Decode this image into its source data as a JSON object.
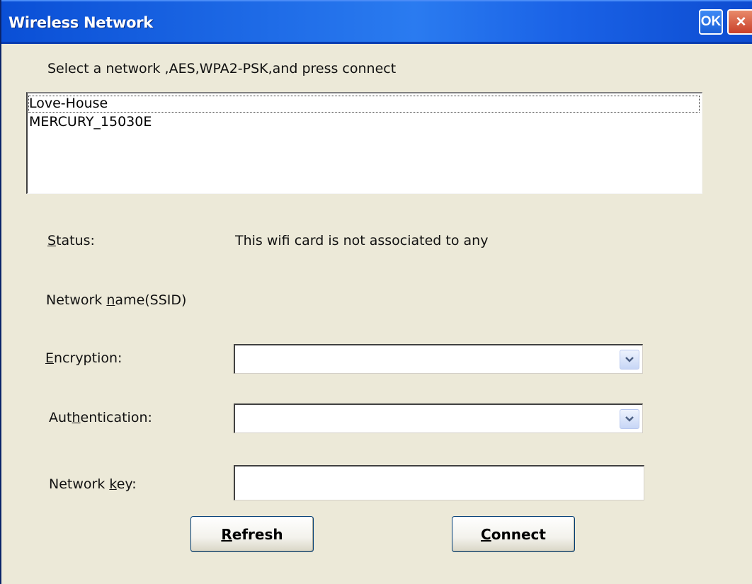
{
  "window": {
    "title": "Wireless Network",
    "ok_label": "OK",
    "close_label": "✕"
  },
  "instruction": "Select a network ,AES,WPA2-PSK,and press connect",
  "networks": [
    "Love-House",
    "MERCURY_15030E"
  ],
  "status": {
    "label_pre": "",
    "label_u": "S",
    "label_post": "tatus:",
    "value": "This wifi card is not associated to any"
  },
  "ssid": {
    "label_pre": "Network ",
    "label_u": "n",
    "label_post": "ame(SSID)"
  },
  "encryption": {
    "label_pre": "",
    "label_u": "E",
    "label_post": "ncryption:",
    "value": ""
  },
  "authentication": {
    "label_pre": "Aut",
    "label_u": "h",
    "label_post": "entication:",
    "value": ""
  },
  "network_key": {
    "label_pre": "Network ",
    "label_u": "k",
    "label_post": "ey:",
    "value": ""
  },
  "buttons": {
    "refresh_u": "R",
    "refresh_rest": "efresh",
    "connect_u": "C",
    "connect_rest": "onnect"
  },
  "colors": {
    "titlebar": "#0a4fd6",
    "dialog_bg": "#ece9d8",
    "close_button": "#c9402a"
  }
}
